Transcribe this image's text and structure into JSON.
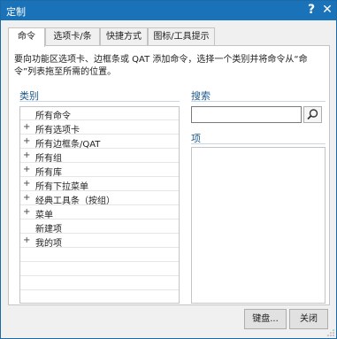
{
  "window": {
    "title": "定制",
    "help_glyph": "?",
    "close_glyph": "✕"
  },
  "tabs": [
    {
      "label": "命令",
      "active": true
    },
    {
      "label": "选项卡/条",
      "active": false
    },
    {
      "label": "快捷方式",
      "active": false
    },
    {
      "label": "图标/工具提示",
      "active": false
    }
  ],
  "intro_text": "要向功能区选项卡、边框条或 QAT 添加命令，选择一个类别并将命令从“命令”列表拖至所需的位置。",
  "category": {
    "label": "类别",
    "items": [
      {
        "label": "所有命令",
        "expandable": false
      },
      {
        "label": "所有选项卡",
        "expandable": true
      },
      {
        "label": "所有边框条/QAT",
        "expandable": true
      },
      {
        "label": "所有组",
        "expandable": true
      },
      {
        "label": "所有库",
        "expandable": true
      },
      {
        "label": "所有下拉菜单",
        "expandable": true
      },
      {
        "label": "经典工具条（按组）",
        "expandable": true
      },
      {
        "label": "菜单",
        "expandable": true
      },
      {
        "label": "新建项",
        "expandable": false
      },
      {
        "label": "我的项",
        "expandable": true
      }
    ]
  },
  "search": {
    "label": "搜索",
    "value": ""
  },
  "items_panel": {
    "label": "项"
  },
  "buttons": {
    "keyboard": "键盘...",
    "close": "关闭"
  },
  "colors": {
    "titlebar": "#1a73b8",
    "section_label": "#1e5a8e"
  }
}
